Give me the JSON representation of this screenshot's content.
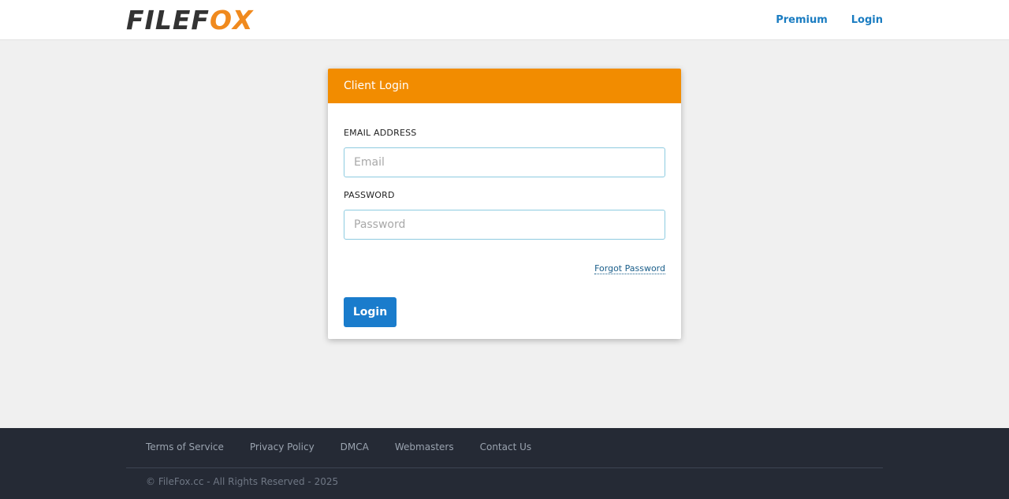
{
  "header": {
    "logo_left": "FILEF",
    "logo_right": "X",
    "logo_fox_glyph": "O",
    "nav": {
      "premium": "Premium",
      "login": "Login"
    }
  },
  "card": {
    "title": "Client Login",
    "email_label": "EMAIL ADDRESS",
    "email_placeholder": "Email",
    "password_label": "PASSWORD",
    "password_placeholder": "Password",
    "forgot_link": "Forgot Password",
    "submit_label": "Login"
  },
  "footer": {
    "links": [
      "Terms of Service",
      "Privacy Policy",
      "DMCA",
      "Webmasters",
      "Contact Us"
    ],
    "copyright": "© FileFox.cc - All Rights Reserved - 2025"
  },
  "colors": {
    "accent_orange": "#f28c00",
    "link_blue": "#1a7cc1",
    "button_blue": "#1a7ccc",
    "footer_bg": "#252a35"
  }
}
